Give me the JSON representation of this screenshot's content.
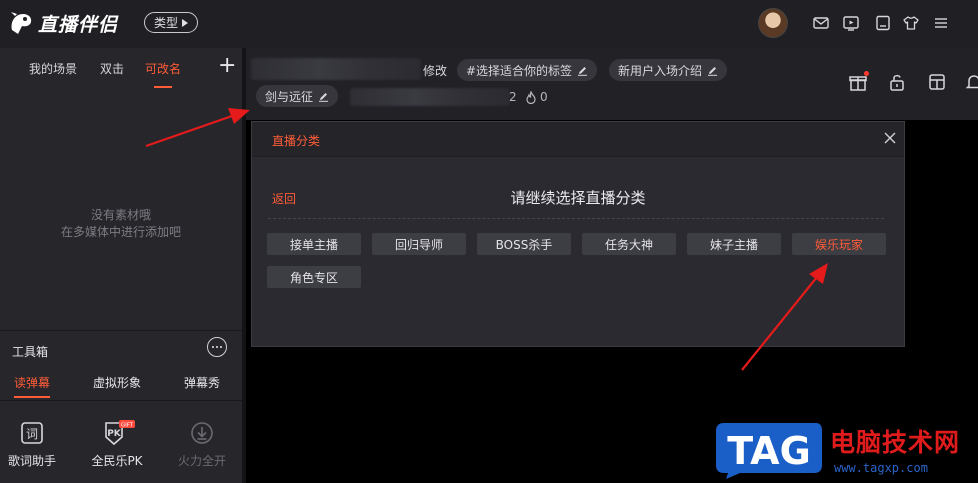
{
  "app": {
    "title": "直播伴侣",
    "type_button": "类型"
  },
  "scene_tabs": [
    "我的场景",
    "双击",
    "可改名"
  ],
  "scene_empty": {
    "line1": "没有素材哦",
    "line2": "在多媒体中进行添加吧"
  },
  "toolbox": {
    "title": "工具箱",
    "tabs": [
      "读弹幕",
      "虚拟形象",
      "弹幕秀"
    ],
    "items": [
      {
        "label": "歌词助手",
        "icon": "lyrics-icon"
      },
      {
        "label": "全民乐PK",
        "icon": "pk-gift-icon",
        "badge": "GIFT"
      },
      {
        "label": "火力全开",
        "icon": "download-icon"
      }
    ]
  },
  "live_info": {
    "edit_text": "修改",
    "tags": [
      "#选择适合你的标签",
      "新用户入场介绍"
    ],
    "game_tag": "剑与远征",
    "partial_number": "2",
    "heat": "0"
  },
  "dialog": {
    "title": "直播分类",
    "back": "返回",
    "prompt": "请继续选择直播分类",
    "categories": [
      "接单主播",
      "回归导师",
      "BOSS杀手",
      "任务大神",
      "妹子主播",
      "娱乐玩家",
      "角色专区"
    ],
    "selected": "娱乐玩家"
  },
  "watermark": {
    "logo": "TAG",
    "cn": "电脑技术网",
    "url": "www.tagxp.com"
  },
  "colors": {
    "accent": "#ff5c38",
    "arrow": "#e51a1a",
    "watermark_blue": "#1a5fc7",
    "watermark_red": "#e01b1b"
  }
}
